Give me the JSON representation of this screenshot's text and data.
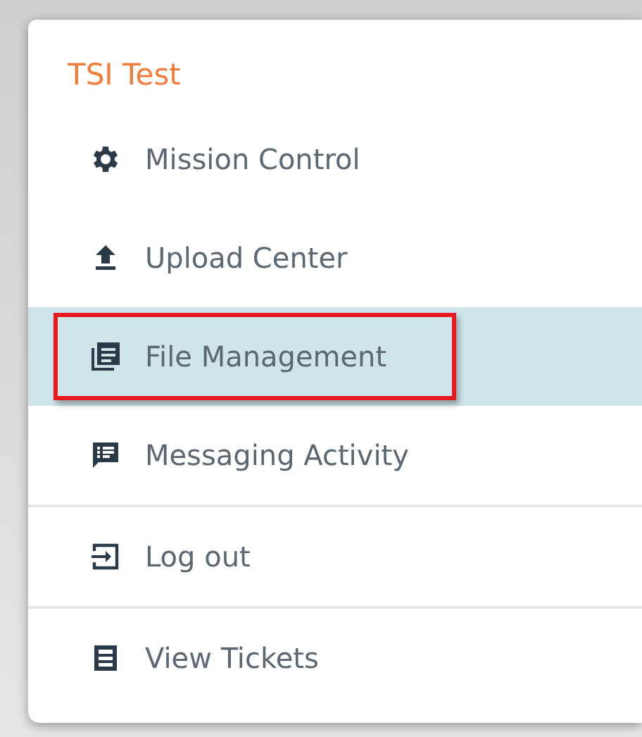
{
  "menu": {
    "title": "TSI Test",
    "sections": [
      [
        {
          "label": "Mission Control",
          "selected": false,
          "outlined": false
        },
        {
          "label": "Upload Center",
          "selected": false,
          "outlined": false
        },
        {
          "label": "File Management",
          "selected": true,
          "outlined": true
        },
        {
          "label": "Messaging Activity",
          "selected": false,
          "outlined": false
        }
      ],
      [
        {
          "label": "Log out",
          "selected": false,
          "outlined": false
        }
      ],
      [
        {
          "label": "View Tickets",
          "selected": false,
          "outlined": false
        }
      ]
    ]
  }
}
